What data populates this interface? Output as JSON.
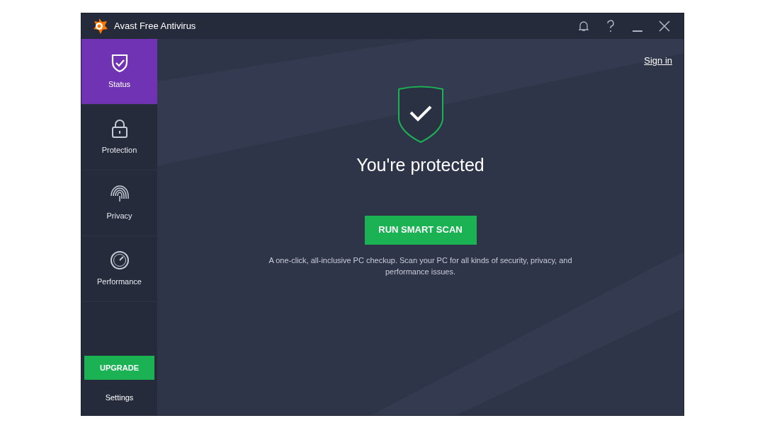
{
  "window": {
    "title": "Avast Free Antivirus"
  },
  "sidebar": {
    "items": [
      {
        "label": "Status",
        "selected": true
      },
      {
        "label": "Protection",
        "selected": false
      },
      {
        "label": "Privacy",
        "selected": false
      },
      {
        "label": "Performance",
        "selected": false
      }
    ],
    "upgrade_button": "UPGRADE",
    "settings": "Settings"
  },
  "main": {
    "sign_in": "Sign in",
    "status": "You're protected",
    "scan_button": "RUN SMART SCAN",
    "description": "A one-click, all-inclusive PC checkup. Scan your PC for all kinds of security, privacy, and performance issues."
  }
}
